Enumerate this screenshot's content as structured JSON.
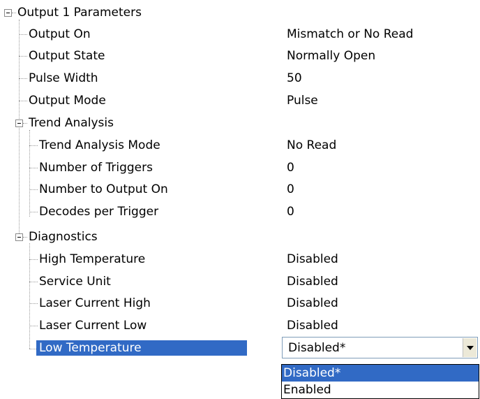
{
  "tree": {
    "root": {
      "label": "Output 1 Parameters",
      "items": [
        {
          "label": "Output On",
          "value": "Mismatch or No Read"
        },
        {
          "label": "Output State",
          "value": "Normally Open"
        },
        {
          "label": "Pulse Width",
          "value": "50"
        },
        {
          "label": "Output Mode",
          "value": "Pulse"
        }
      ]
    },
    "trend_analysis": {
      "label": "Trend Analysis",
      "items": [
        {
          "label": "Trend Analysis Mode",
          "value": "No Read"
        },
        {
          "label": "Number of Triggers",
          "value": "0"
        },
        {
          "label": "Number to Output On",
          "value": "0"
        },
        {
          "label": "Decodes per Trigger",
          "value": "0"
        }
      ]
    },
    "diagnostics": {
      "label": "Diagnostics",
      "items": [
        {
          "label": "High Temperature",
          "value": "Disabled"
        },
        {
          "label": "Service Unit",
          "value": "Disabled"
        },
        {
          "label": "Laser Current High",
          "value": "Disabled"
        },
        {
          "label": "Laser Current Low",
          "value": "Disabled"
        },
        {
          "label": "Low Temperature",
          "value": "Disabled*"
        }
      ]
    }
  },
  "dropdown": {
    "selected": "Disabled*",
    "options": [
      "Disabled*",
      "Enabled"
    ]
  },
  "colors": {
    "selection": "#316ac5",
    "tree_line": "#9a9a9a"
  },
  "icons": {
    "collapse": "collapse-minus-icon",
    "dropdown_arrow": "chevron-down-icon"
  }
}
